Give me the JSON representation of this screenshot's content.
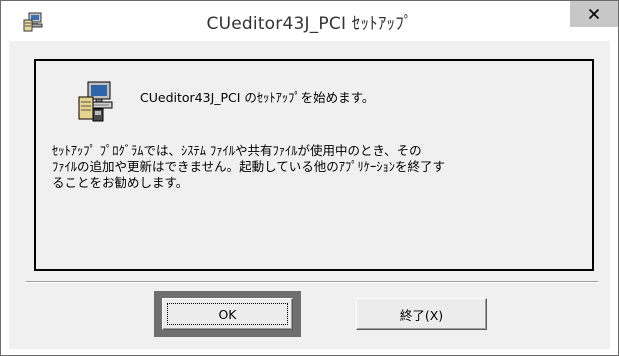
{
  "window": {
    "title": "CUeditor43J_PCI ｾｯﾄｱｯﾌﾟ",
    "close_glyph": "✕"
  },
  "content": {
    "headline": "CUeditor43J_PCI のｾｯﾄｱｯﾌﾟを始めます。",
    "body_lines": [
      "ｾｯﾄｱｯﾌﾟ ﾌﾟﾛｸﾞﾗﾑでは、ｼｽﾃﾑ ﾌｧｲﾙや共有ﾌｧｲﾙが使用中のとき、その",
      "ﾌｧｲﾙの追加や更新はできません。起動している他のｱﾌﾟﾘｹｰｼｮﾝを終了す",
      "ることをお勧めします。"
    ]
  },
  "buttons": {
    "ok_label": "OK",
    "exit_label": "終了(X)"
  },
  "icons": {
    "title_icon": "computer-setup-icon",
    "main_icon": "computer-setup-icon"
  },
  "colors": {
    "client_bg": "#f0f0f0",
    "close_bg": "#c7c7c7",
    "focus_frame": "#6f6f6f"
  }
}
